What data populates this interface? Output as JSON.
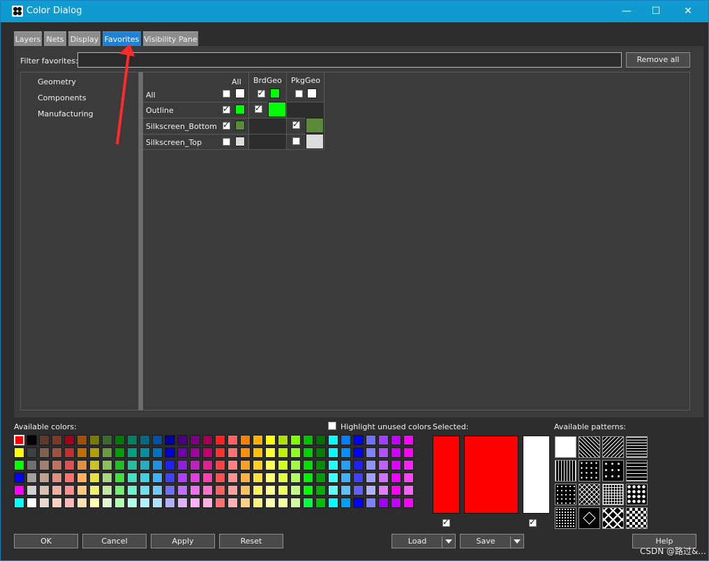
{
  "window": {
    "title": "Color Dialog",
    "controls": {
      "minimize": "—",
      "maximize": "☐",
      "close": "✕"
    }
  },
  "tabs": [
    {
      "label": "Layers",
      "active": false
    },
    {
      "label": "Nets",
      "active": false
    },
    {
      "label": "Display",
      "active": false
    },
    {
      "label": "Favorites",
      "active": true
    },
    {
      "label": "Visibility Pane",
      "active": false
    }
  ],
  "filter": {
    "label": "Filter favorites:",
    "value": "",
    "remove_all_label": "Remove all"
  },
  "tree": {
    "items": [
      "Geometry",
      "Components",
      "Manufacturing"
    ]
  },
  "grid": {
    "column_headers": [
      "All",
      "BrdGeo",
      "PkgGeo"
    ],
    "rows": [
      {
        "label": "All"
      },
      {
        "label": "Outline"
      },
      {
        "label": "Silkscreen_Bottom"
      },
      {
        "label": "Silkscreen_Top"
      }
    ]
  },
  "available_colors": {
    "label": "Available colors:",
    "rows": [
      [
        "#ff0000",
        "#000000",
        "#5c3b2a",
        "#7a3a26",
        "#a0001c",
        "#a05000",
        "#7a7a00",
        "#3c6a2c",
        "#007a00",
        "#008060",
        "#006a80",
        "#0050a0",
        "#0000a0",
        "#4c0080",
        "#7a0080",
        "#a00050",
        "#ff2020",
        "#ff6060",
        "#ff8000",
        "#ffb000",
        "#ffff00",
        "#b0e000",
        "#80ff00",
        "#00c000",
        "#007000",
        "#00ffff",
        "#0080ff",
        "#0000ff",
        "#7070ff",
        "#a040ff",
        "#c000ff",
        "#ff00ff"
      ],
      [
        "#ffff00",
        "#404040",
        "#806050",
        "#a05040",
        "#c03030",
        "#c07000",
        "#b0a000",
        "#6a9a40",
        "#00a000",
        "#00a080",
        "#0090a0",
        "#0070c0",
        "#0000d0",
        "#7000b0",
        "#a000a0",
        "#c00070",
        "#ff3030",
        "#ff7070",
        "#ff9000",
        "#ffc000",
        "#ffff30",
        "#c0f000",
        "#90ff20",
        "#00d000",
        "#008000",
        "#00ffff",
        "#0090ff",
        "#0000ff",
        "#8080ff",
        "#b050ff",
        "#d000ff",
        "#ff00ff"
      ],
      [
        "#00ff00",
        "#707070",
        "#a08070",
        "#c07060",
        "#e05050",
        "#e09040",
        "#d0c020",
        "#8ac060",
        "#20c020",
        "#20c0a0",
        "#20b0c0",
        "#2090e0",
        "#2020ff",
        "#9020e0",
        "#c020c0",
        "#e02090",
        "#ff4040",
        "#ff8080",
        "#ffa020",
        "#ffd020",
        "#ffff50",
        "#d0ff20",
        "#a0ff40",
        "#00e000",
        "#009000",
        "#20ffff",
        "#20a0ff",
        "#2020ff",
        "#9090ff",
        "#c060ff",
        "#e000ff",
        "#ff20ff"
      ],
      [
        "#0000ff",
        "#a0a0a0",
        "#c0a090",
        "#e09080",
        "#ff7070",
        "#ffb060",
        "#e8e040",
        "#a8d880",
        "#40e040",
        "#40e0c0",
        "#40d0e0",
        "#40b0ff",
        "#4040ff",
        "#b040ff",
        "#e040e0",
        "#ff40b0",
        "#ff5050",
        "#ff9090",
        "#ffb040",
        "#ffe040",
        "#ffff70",
        "#e0ff40",
        "#b0ff60",
        "#00f000",
        "#00a000",
        "#40ffff",
        "#40b0ff",
        "#4040ff",
        "#a0a0ff",
        "#d070ff",
        "#f000ff",
        "#ff40ff"
      ],
      [
        "#ff00ff",
        "#d0d0d0",
        "#d8c0b0",
        "#f0b0a0",
        "#ff9090",
        "#ffc880",
        "#f0f070",
        "#c0e8a0",
        "#70f070",
        "#70f0d0",
        "#70e0f0",
        "#70c8ff",
        "#7070ff",
        "#c070ff",
        "#f070f0",
        "#ff70c8",
        "#ff6060",
        "#ffa0a0",
        "#ffc060",
        "#fff060",
        "#ffff90",
        "#f0ff60",
        "#c0ff80",
        "#00ff00",
        "#00b000",
        "#60ffff",
        "#60c0ff",
        "#6060ff",
        "#b0b0ff",
        "#e080ff",
        "#ff00ff",
        "#ff60ff"
      ],
      [
        "#00ffff",
        "#ffffff",
        "#e8d8d0",
        "#ffd0c0",
        "#ffb8b8",
        "#ffe0b0",
        "#ffffb0",
        "#e0f8d0",
        "#b0ffb0",
        "#b0ffe8",
        "#b0f0ff",
        "#b0e0ff",
        "#b0b0ff",
        "#e0b0ff",
        "#ffb0ff",
        "#ffb0e0",
        "#ff7070",
        "#ffb0b0",
        "#ffd080",
        "#fff080",
        "#ffffb0",
        "#f8ffa0",
        "#d0ffa0",
        "#00ff40",
        "#00c000",
        "#00ffff",
        "#00a0ff",
        "#0000ff",
        "#8080ff",
        "#a000ff",
        "#c000ff",
        "#ff00ff"
      ]
    ]
  },
  "highlight_unused": {
    "label": "Highlight unused colors",
    "checked": false
  },
  "selected": {
    "label": "Selected:",
    "primary": "#ff0000",
    "secondary": "#ffffff"
  },
  "available_patterns": {
    "label": "Available patterns:"
  },
  "buttons": {
    "ok": "OK",
    "cancel": "Cancel",
    "apply": "Apply",
    "reset": "Reset",
    "load": "Load",
    "save": "Save",
    "help": "Help"
  },
  "watermark": "CSDN @路过&..."
}
